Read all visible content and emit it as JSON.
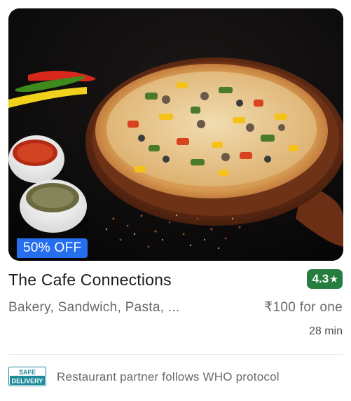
{
  "restaurant": {
    "name": "The Cafe Connections",
    "rating": "4.3",
    "rating_icon": "star-icon",
    "cuisines": "Bakery, Sandwich, Pasta, ...",
    "price": "₹100 for one",
    "delivery_time": "28 min",
    "offer": "50% OFF"
  },
  "safety": {
    "badge_line1": "SAFE",
    "badge_line2": "DELIVERY",
    "text": "Restaurant partner follows WHO protocol"
  },
  "colors": {
    "offer_badge": "#256fef",
    "rating_badge": "#267e3e",
    "safe_badge": "#1f8a99",
    "secondary_text": "#696969"
  }
}
